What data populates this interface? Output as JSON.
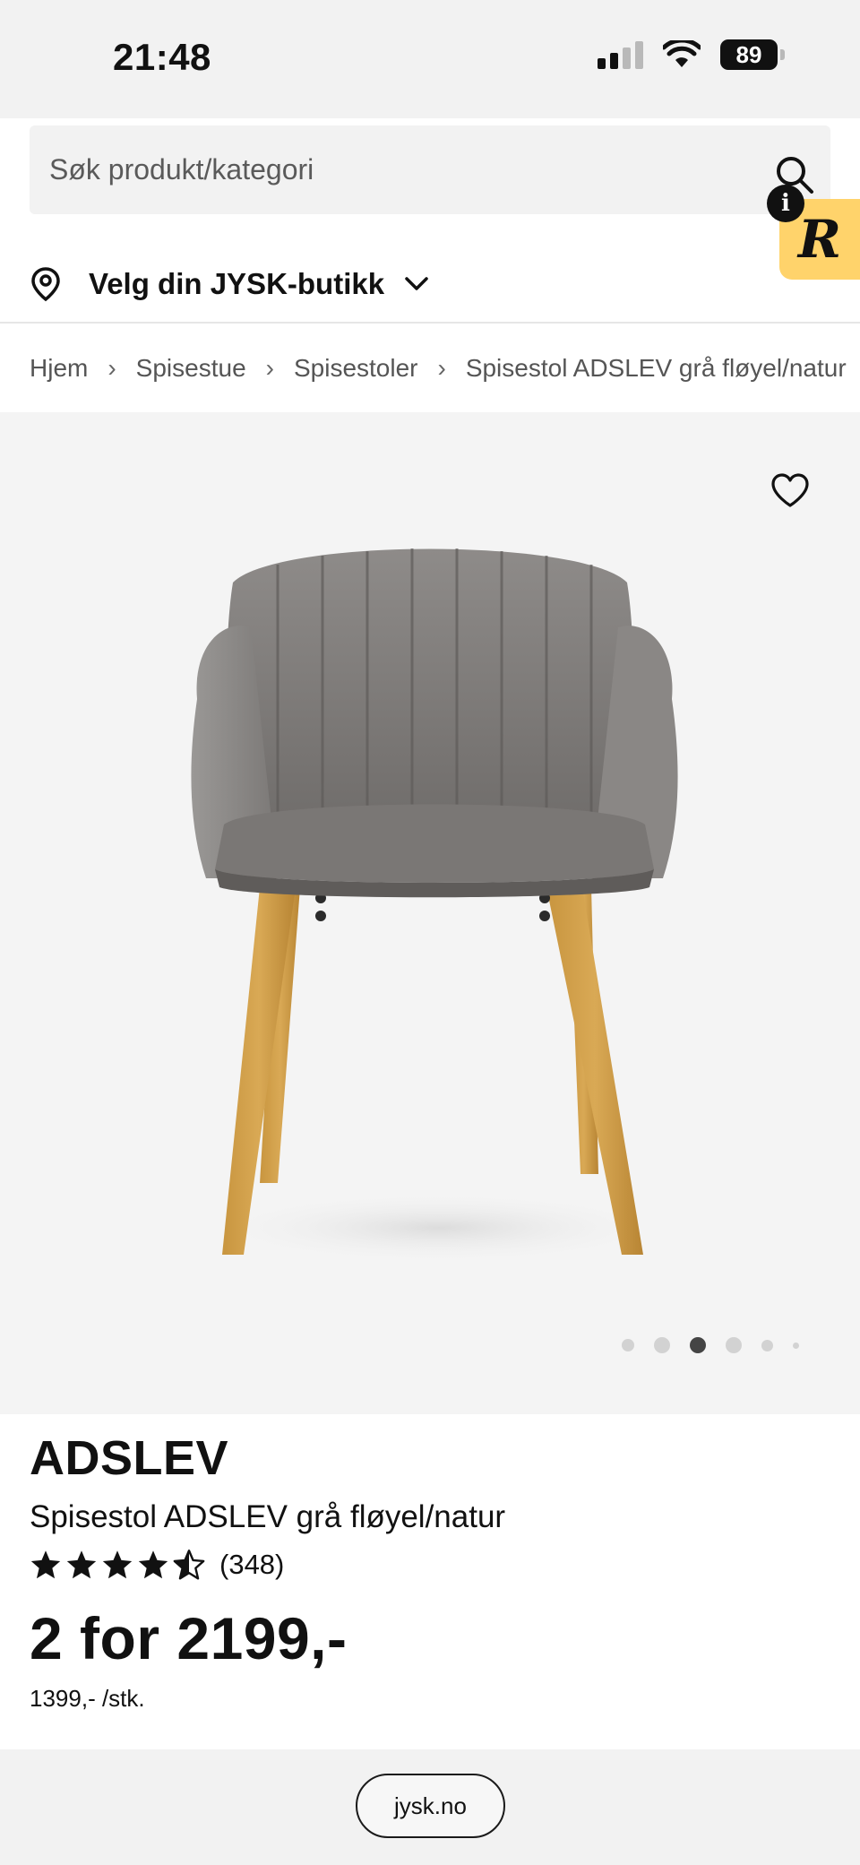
{
  "status_bar": {
    "time": "21:48",
    "battery": "89"
  },
  "header": {
    "search_placeholder": "Søk produkt/kategori",
    "store_label": "Velg din JYSK-butikk",
    "extension_letter": "R",
    "info_glyph": "i"
  },
  "breadcrumb": {
    "items": [
      "Hjem",
      "Spisestue",
      "Spisestoler",
      "Spisestol ADSLEV grå fløyel/natur"
    ],
    "separator": "›"
  },
  "gallery": {
    "image_count": 6,
    "active_index": 2
  },
  "product": {
    "brand": "ADSLEV",
    "name": "Spisestol ADSLEV grå fløyel/natur",
    "rating": 4.5,
    "rating_max": 5,
    "review_count": "(348)",
    "price": "2 for 2199,-",
    "unit_price": "1399,- /stk."
  },
  "browser": {
    "url": "jysk.no"
  },
  "colors": {
    "accent_tab": "#ffd36b",
    "text": "#111111",
    "page_bg": "#f2f2f2"
  },
  "icons": [
    "search-icon",
    "info-icon",
    "location-pin-icon",
    "chevron-down-icon",
    "heart-icon",
    "star-icon",
    "signal-icon",
    "wifi-icon",
    "battery-icon"
  ]
}
